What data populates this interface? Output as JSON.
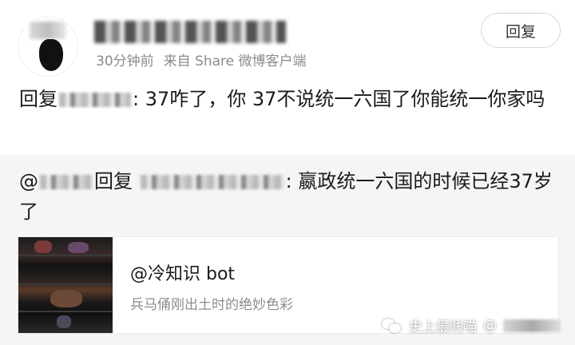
{
  "comment": {
    "meta": {
      "time": "30分钟前",
      "source": "来自 Share 微博客户端"
    },
    "reply_button": "回复",
    "text_prefix": "回复",
    "text_body": ": 37咋了，你 37不说统一六国了你能统一你家吗"
  },
  "quoted": {
    "prefix": "@",
    "reply_word": "回复",
    "text_body": ": 嬴政统一六国的时候已经37岁了"
  },
  "card": {
    "title": "@冷知识 bot",
    "description": "兵马俑刚出土时的绝妙色彩"
  },
  "watermark": {
    "channel": "史上最贱喵",
    "weibo_prefix": "@"
  },
  "colors": {
    "background": "#ffffff",
    "quoted_background": "#f5f5f5",
    "meta_text": "#8c8c8c"
  }
}
